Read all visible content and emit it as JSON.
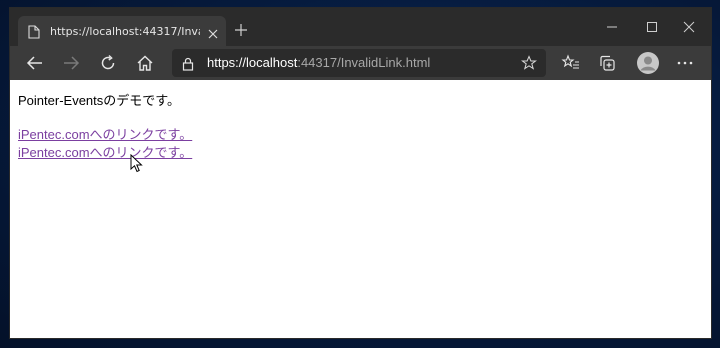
{
  "tab": {
    "title": "https://localhost:44317/InvalidLink.html",
    "icon": "page-icon",
    "close_icon": "close-icon",
    "new_tab_icon": "plus-icon"
  },
  "window_controls": [
    "minimize-icon",
    "maximize-icon",
    "close-icon"
  ],
  "toolbar": {
    "icons": [
      "back-arrow-icon",
      "forward-arrow-icon",
      "refresh-icon",
      "home-icon"
    ],
    "address": {
      "scheme_host": "https://localhost",
      "rest": ":44317/InvalidLink.html",
      "lock_icon": "lock-icon",
      "favorite_icon": "star-icon"
    },
    "right_icons": [
      "favorites-list-icon",
      "collections-icon",
      "profile-avatar-icon",
      "more-icon"
    ]
  },
  "page": {
    "heading_text": "Pointer-Eventsのデモです。",
    "links": [
      "iPentec.comへのリンクです。",
      "iPentec.comへのリンクです。"
    ],
    "link_color": "#7b3fa0"
  },
  "colors": {
    "titlebar": "#2b2b2b",
    "toolbar": "#3b3b3b",
    "desktop": "#061a3c"
  }
}
